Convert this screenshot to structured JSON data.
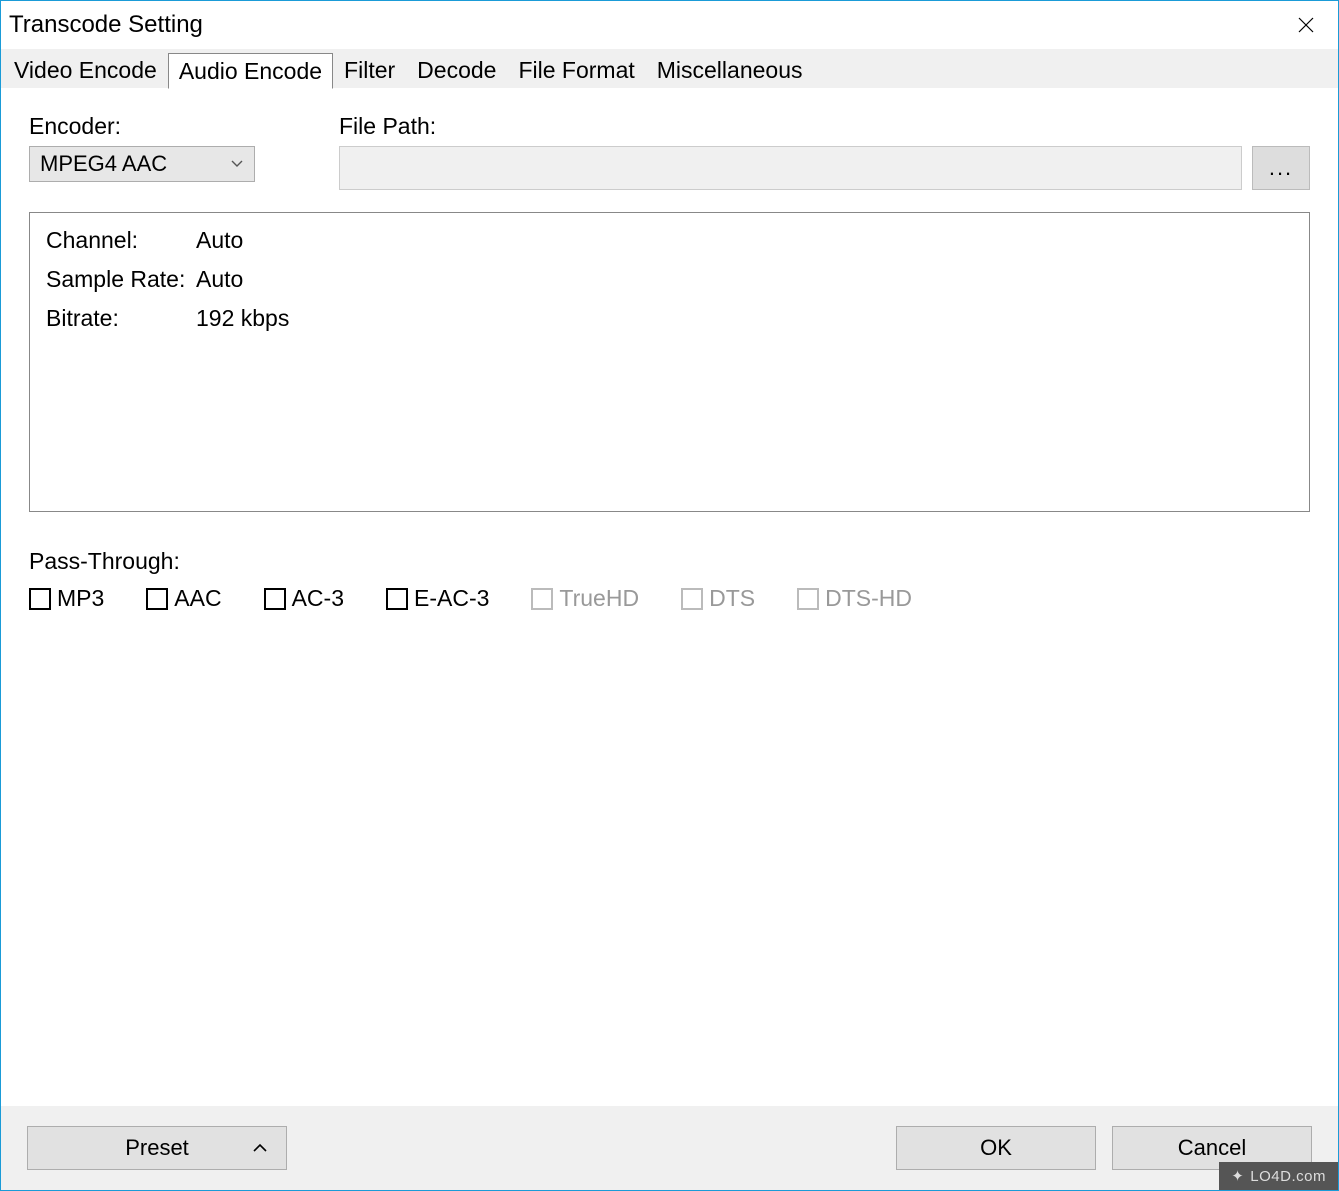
{
  "window": {
    "title": "Transcode Setting"
  },
  "tabs": [
    {
      "label": "Video Encode",
      "active": false
    },
    {
      "label": "Audio Encode",
      "active": true
    },
    {
      "label": "Filter",
      "active": false
    },
    {
      "label": "Decode",
      "active": false
    },
    {
      "label": "File Format",
      "active": false
    },
    {
      "label": "Miscellaneous",
      "active": false
    }
  ],
  "encoder": {
    "label": "Encoder:",
    "value": "MPEG4 AAC"
  },
  "filepath": {
    "label": "File Path:",
    "value": "",
    "browse_label": "..."
  },
  "panel": {
    "rows": [
      {
        "k": "Channel:",
        "v": "Auto"
      },
      {
        "k": "Sample Rate:",
        "v": "Auto"
      },
      {
        "k": "Bitrate:",
        "v": "192 kbps"
      }
    ]
  },
  "passthrough": {
    "title": "Pass-Through:",
    "items": [
      {
        "label": "MP3",
        "enabled": true
      },
      {
        "label": "AAC",
        "enabled": true
      },
      {
        "label": "AC-3",
        "enabled": true
      },
      {
        "label": "E-AC-3",
        "enabled": true
      },
      {
        "label": "TrueHD",
        "enabled": false
      },
      {
        "label": "DTS",
        "enabled": false
      },
      {
        "label": "DTS-HD",
        "enabled": false
      }
    ]
  },
  "footer": {
    "preset": "Preset",
    "ok": "OK",
    "cancel": "Cancel"
  },
  "watermark": "LO4D.com"
}
